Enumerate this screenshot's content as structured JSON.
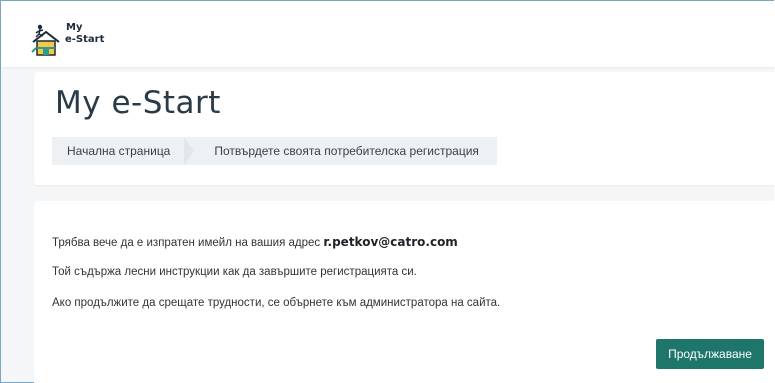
{
  "logo": {
    "icon": "house-with-runner-icon",
    "text_top": "My",
    "text_bottom": "e-Start"
  },
  "page": {
    "title": "My e-Start"
  },
  "breadcrumb": {
    "home": "Начална страница",
    "current": "Потвърдете своята потребителска регистрация"
  },
  "message": {
    "line1_prefix": "Трябва вече да е изпратен имейл на вашия адрес ",
    "email": "r.petkov@catro.com",
    "line2": "Той съдържа лесни инструкции как да завършите регистрацията си.",
    "line3": "Ако продължите да срещате трудности, се обърнете към администратора на сайта."
  },
  "actions": {
    "continue_label": "Продължаване"
  },
  "colors": {
    "accent": "#1e766b",
    "background": "#f4f6f8",
    "breadcrumb_bg": "#eef1f4",
    "title_text": "#2b3a47"
  }
}
